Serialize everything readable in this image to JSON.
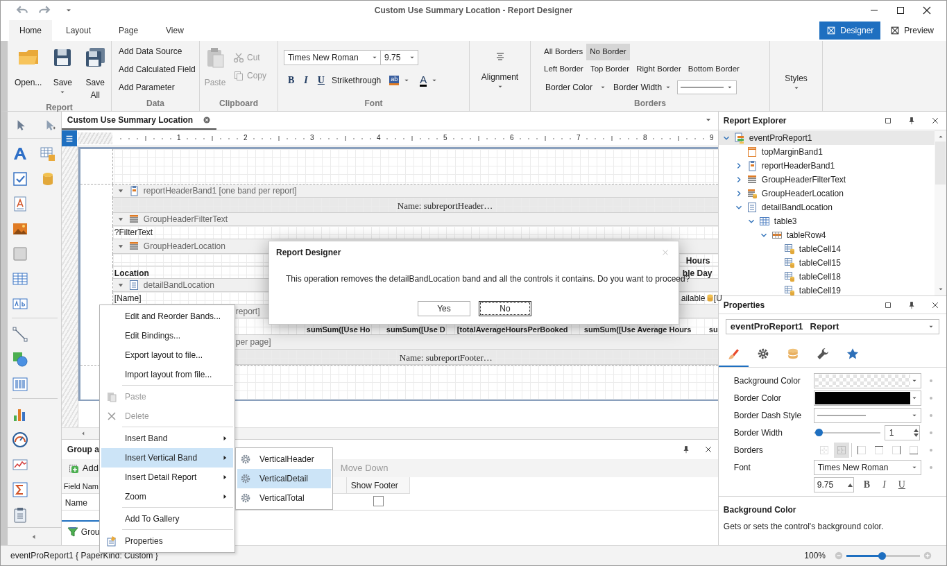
{
  "window": {
    "title": "Custom Use Summary Location - Report Designer"
  },
  "ribbon_tabs": [
    {
      "label": "Home",
      "selected": true
    },
    {
      "label": "Layout",
      "selected": false
    },
    {
      "label": "Page",
      "selected": false
    },
    {
      "label": "View",
      "selected": false
    }
  ],
  "view_modes": [
    {
      "label": "Designer",
      "selected": true
    },
    {
      "label": "Preview",
      "selected": false
    }
  ],
  "ribbon": {
    "report": {
      "title": "Report",
      "open": "Open...",
      "save": "Save",
      "save_all": "Save All"
    },
    "data": {
      "title": "Data",
      "items": [
        "Add Data Source",
        "Add Calculated Field",
        "Add Parameter"
      ]
    },
    "clipboard": {
      "title": "Clipboard",
      "paste": {
        "label": "Paste",
        "disabled": true
      },
      "cut": {
        "label": "Cut",
        "disabled": true
      },
      "copy": {
        "label": "Copy",
        "disabled": true
      }
    },
    "font": {
      "title": "Font",
      "family": "Times New Roman",
      "size": "9.75",
      "bold": "B",
      "italic": "I",
      "underline": "U",
      "strikethrough": "Strikethrough",
      "highlight": "ab",
      "font_color": "A"
    },
    "alignment": {
      "label": "Alignment"
    },
    "borders": {
      "title": "Borders",
      "items": [
        {
          "label": "All Borders",
          "selected": false
        },
        {
          "label": "No Border",
          "selected": true
        },
        {
          "label": "Left Border",
          "selected": false
        },
        {
          "label": "Top Border",
          "selected": false
        },
        {
          "label": "Right Border",
          "selected": false
        },
        {
          "label": "Bottom Border",
          "selected": false
        }
      ],
      "border_color": "Border Color",
      "border_width": "Border Width"
    },
    "styles": {
      "label": "Styles"
    }
  },
  "document": {
    "tab": "Custom Use Summary Location",
    "ruler": [
      "1",
      "2",
      "3",
      "4",
      "5",
      "6",
      "7",
      "8",
      "9"
    ],
    "bands": [
      {
        "kind": "margin"
      },
      {
        "kind": "caption",
        "label": "reportHeaderBand1 [one band per report]",
        "expanded": true
      },
      {
        "kind": "content",
        "cells": [
          "Name: subreportHeader…"
        ]
      },
      {
        "kind": "caption",
        "label": "GroupHeaderFilterText",
        "expanded": true
      },
      {
        "kind": "content",
        "cells": [
          "?FilterText"
        ]
      },
      {
        "kind": "caption",
        "label": "GroupHeaderLocation",
        "expanded": true
      },
      {
        "kind": "content",
        "cells": [
          "Hours"
        ]
      },
      {
        "kind": "content",
        "cells": [
          "Location",
          "ble Day"
        ]
      },
      {
        "kind": "caption",
        "label": "detailBandLocation",
        "expanded": true
      },
      {
        "kind": "content",
        "cells": [
          "[Name]",
          "ailable",
          "[U"
        ]
      },
      {
        "kind": "caption_part",
        "label": "report]"
      },
      {
        "kind": "content",
        "cells": [
          "sumSum([Use Ho",
          "sumSum([Use D",
          "[totalAverageHoursPerBooked",
          "sumSum([Use Average Hours",
          "su"
        ]
      },
      {
        "kind": "caption_part",
        "label": "per page]"
      },
      {
        "kind": "content",
        "cells": [
          "Name: subreportFooter…"
        ]
      },
      {
        "kind": "margin"
      }
    ]
  },
  "group_sort": {
    "title": "Group a",
    "add": "Add",
    "move_down": {
      "label": "Move Down",
      "disabled": true
    },
    "columns": [
      "Field Nam",
      "Show Footer"
    ],
    "rows": [
      {
        "field": "Name",
        "show_footer": false
      }
    ],
    "tab": "Grou"
  },
  "report_explorer": {
    "title": "Report Explorer",
    "tree": [
      {
        "label": "eventProReport1",
        "kind": "report",
        "selected": true,
        "expanded": true,
        "children": [
          {
            "label": "topMarginBand1",
            "kind": "margin",
            "selected": false
          },
          {
            "label": "reportHeaderBand1",
            "kind": "band",
            "selected": false,
            "expanded": false
          },
          {
            "label": "GroupHeaderFilterText",
            "kind": "group_header",
            "selected": false,
            "expanded": false
          },
          {
            "label": "GroupHeaderLocation",
            "kind": "group_header_data",
            "selected": false,
            "expanded": false
          },
          {
            "label": "detailBandLocation",
            "kind": "detail",
            "selected": false,
            "expanded": true,
            "children": [
              {
                "label": "table3",
                "kind": "table",
                "selected": false,
                "expanded": true,
                "children": [
                  {
                    "label": "tableRow4",
                    "kind": "row",
                    "selected": false,
                    "expanded": true,
                    "children": [
                      {
                        "label": "tableCell14",
                        "kind": "cell",
                        "selected": false
                      },
                      {
                        "label": "tableCell15",
                        "kind": "cell",
                        "selected": false
                      },
                      {
                        "label": "tableCell18",
                        "kind": "cell",
                        "selected": false
                      },
                      {
                        "label": "tableCell19",
                        "kind": "cell",
                        "selected": false
                      }
                    ]
                  }
                ]
              }
            ]
          }
        ]
      }
    ]
  },
  "properties": {
    "title": "Properties",
    "object": "eventProReport1",
    "type": "Report",
    "tabs": [
      {
        "selected": true
      },
      {
        "selected": false
      },
      {
        "selected": false
      },
      {
        "selected": false
      },
      {
        "selected": false
      }
    ],
    "rows": [
      {
        "label": "Background Color",
        "kind": "transparent"
      },
      {
        "label": "Border Color",
        "kind": "color",
        "color": "#000000"
      },
      {
        "label": "Border Dash Style",
        "kind": "dash"
      },
      {
        "label": "Border Width",
        "kind": "slider",
        "level": 0.08,
        "value": "1"
      },
      {
        "label": "Borders",
        "kind": "borders",
        "items": [
          {
            "selected": false
          },
          {
            "selected": true
          },
          {
            "selected": false
          },
          {
            "selected": false
          },
          {
            "selected": false
          },
          {
            "selected": false
          }
        ]
      },
      {
        "label": "Font",
        "kind": "text",
        "value": "Times New Roman"
      },
      {
        "kind": "font_size",
        "value": "9.75",
        "bold": "B",
        "italic": "I",
        "underline": "U"
      }
    ],
    "description": {
      "title": "Background Color",
      "text": "Gets or sets the control's background color."
    }
  },
  "dialog": {
    "title": "Report Designer",
    "message": "This operation removes the detailBandLocation band and all the controls it contains. Do you want to proceed?",
    "buttons": [
      {
        "label": "Yes",
        "focused": false
      },
      {
        "label": "No",
        "focused": true
      }
    ]
  },
  "context_menu": {
    "items": [
      {
        "kind": "item",
        "label": "Edit and Reorder Bands...",
        "disabled": false,
        "selected": false,
        "submenu": false
      },
      {
        "kind": "item",
        "label": "Edit Bindings...",
        "disabled": false,
        "selected": false,
        "submenu": false
      },
      {
        "kind": "item",
        "label": "Export layout to file...",
        "disabled": false,
        "selected": false,
        "submenu": false
      },
      {
        "kind": "item",
        "label": "Import layout from file...",
        "disabled": false,
        "selected": false,
        "submenu": false
      },
      {
        "kind": "separator"
      },
      {
        "kind": "item",
        "label": "Paste",
        "disabled": true,
        "selected": false,
        "submenu": false
      },
      {
        "kind": "item",
        "label": "Delete",
        "disabled": true,
        "selected": false,
        "submenu": false
      },
      {
        "kind": "separator"
      },
      {
        "kind": "item",
        "label": "Insert Band",
        "disabled": false,
        "selected": false,
        "submenu": true
      },
      {
        "kind": "item",
        "label": "Insert Vertical Band",
        "disabled": false,
        "selected": true,
        "submenu": true
      },
      {
        "kind": "item",
        "label": "Insert Detail Report",
        "disabled": false,
        "selected": false,
        "submenu": true
      },
      {
        "kind": "item",
        "label": "Zoom",
        "disabled": false,
        "selected": false,
        "submenu": true
      },
      {
        "kind": "separator"
      },
      {
        "kind": "item",
        "label": "Add To Gallery",
        "disabled": false,
        "selected": false,
        "submenu": false
      },
      {
        "kind": "separator"
      },
      {
        "kind": "item",
        "label": "Properties",
        "disabled": false,
        "selected": false,
        "submenu": false
      }
    ],
    "submenu": [
      {
        "label": "VerticalHeader",
        "selected": false
      },
      {
        "label": "VerticalDetail",
        "selected": true
      },
      {
        "label": "VerticalTotal",
        "selected": false
      }
    ]
  },
  "status_bar": {
    "text": "eventProReport1 { PaperKind: Custom }",
    "zoom": "100%",
    "zoom_slider": {
      "level": 0.48
    }
  }
}
